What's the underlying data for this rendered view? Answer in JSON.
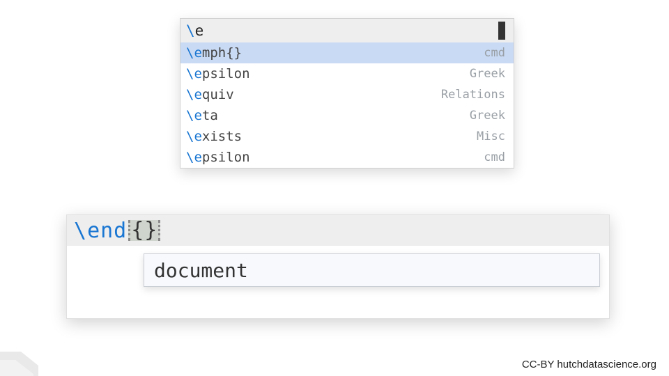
{
  "popup": {
    "typed_prefix": "\\",
    "typed_letter": "e",
    "suggestions": [
      {
        "prefix": "\\",
        "match": "e",
        "rest": "mph{}",
        "category": "cmd",
        "selected": true
      },
      {
        "prefix": "\\",
        "match": "e",
        "rest": "psilon",
        "category": "Greek",
        "selected": false
      },
      {
        "prefix": "\\",
        "match": "e",
        "rest": "quiv",
        "category": "Relations",
        "selected": false
      },
      {
        "prefix": "\\",
        "match": "e",
        "rest": "ta",
        "category": "Greek",
        "selected": false
      },
      {
        "prefix": "\\",
        "match": "e",
        "rest": "xists",
        "category": "Misc",
        "selected": false
      },
      {
        "prefix": "\\",
        "match": "e",
        "rest": "psilon",
        "category": "cmd",
        "selected": false
      }
    ]
  },
  "editor": {
    "command_slash": "\\",
    "command_name": "end",
    "brace_content": "{}",
    "hint": "document"
  },
  "credit": "CC-BY hutchdatascience.org"
}
